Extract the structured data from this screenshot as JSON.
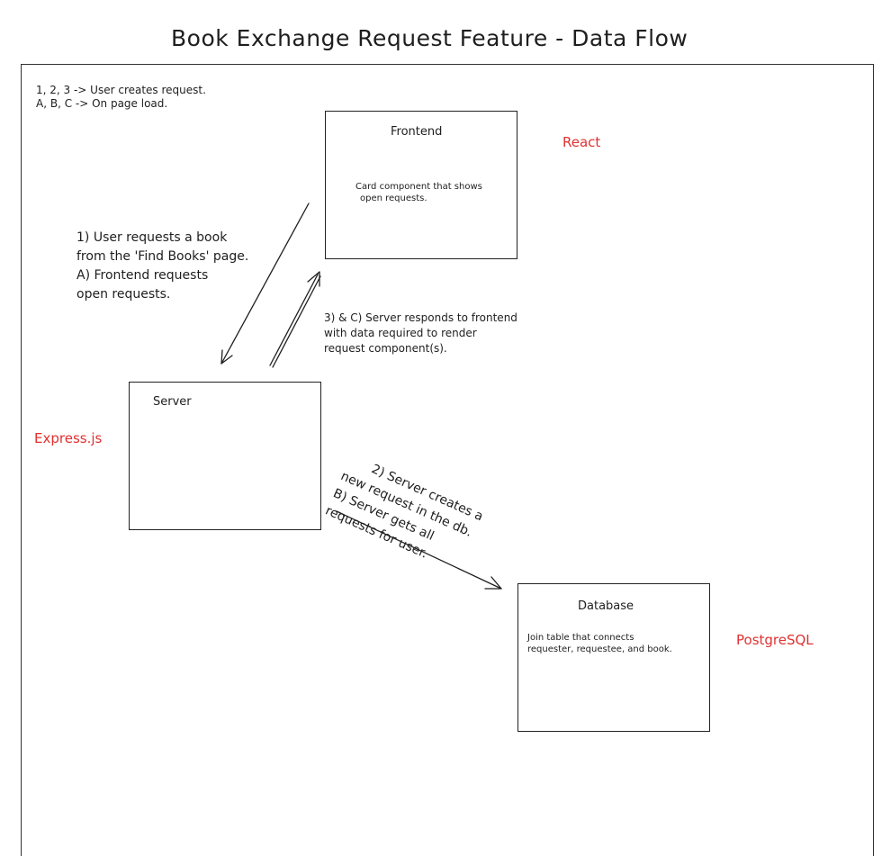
{
  "title": "Book Exchange Request Feature - Data Flow",
  "legend": {
    "line1": "1, 2, 3 -> User creates request.",
    "line2": "A, B, C -> On page load."
  },
  "boxes": {
    "frontend": {
      "title": "Frontend",
      "desc_line1": "Card component that shows",
      "desc_line2": "open requests."
    },
    "server": {
      "title": "Server"
    },
    "database": {
      "title": "Database",
      "desc_line1": "Join table that connects",
      "desc_line2": "requester, requestee, and book."
    }
  },
  "tech": {
    "react": "React",
    "express": "Express.js",
    "postgres": "PostgreSQL",
    "color": "#e03131"
  },
  "notes": {
    "step1": {
      "line1": "1) User requests a book",
      "line2": "from the 'Find Books' page.",
      "line3": "A) Frontend requests",
      "line4": "open requests."
    },
    "step3": {
      "line1": "3) & C) Server responds to frontend",
      "line2": "with data required to render",
      "line3": "request component(s)."
    },
    "step2": {
      "line1": "2) Server creates a",
      "line2": "new request in the db.",
      "line3": "B) Server gets all",
      "line4": "requests for user."
    }
  }
}
